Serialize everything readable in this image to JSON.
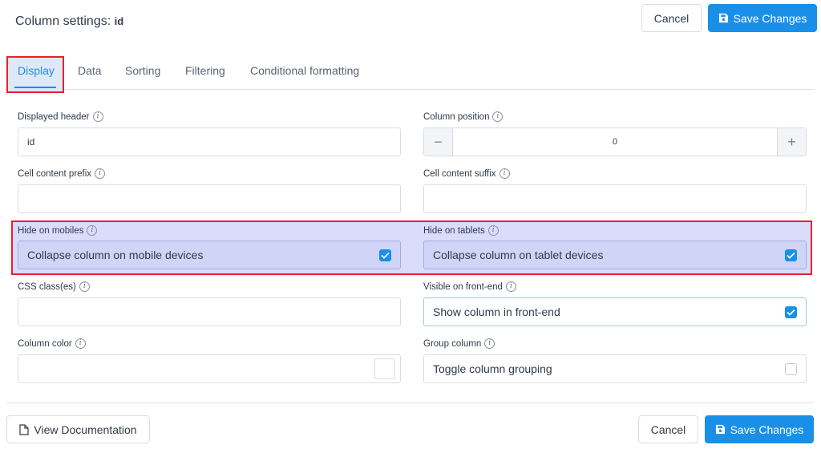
{
  "header": {
    "title_prefix": "Column settings:",
    "column_name": "id",
    "cancel_label": "Cancel",
    "save_label": "Save Changes"
  },
  "tabs": [
    {
      "label": "Display",
      "active": true
    },
    {
      "label": "Data",
      "active": false
    },
    {
      "label": "Sorting",
      "active": false
    },
    {
      "label": "Filtering",
      "active": false
    },
    {
      "label": "Conditional formatting",
      "active": false
    }
  ],
  "fields": {
    "displayed_header": {
      "label": "Displayed header",
      "value": "id"
    },
    "column_position": {
      "label": "Column position",
      "value": "0",
      "minus": "−",
      "plus": "+"
    },
    "cell_prefix": {
      "label": "Cell content prefix",
      "value": ""
    },
    "cell_suffix": {
      "label": "Cell content suffix",
      "value": ""
    },
    "hide_mobiles": {
      "label": "Hide on mobiles",
      "option": "Collapse column on mobile devices",
      "checked": true
    },
    "hide_tablets": {
      "label": "Hide on tablets",
      "option": "Collapse column on tablet devices",
      "checked": true
    },
    "css_classes": {
      "label": "CSS class(es)",
      "value": ""
    },
    "visible_frontend": {
      "label": "Visible on front-end",
      "option": "Show column in front-end",
      "checked": true
    },
    "column_color": {
      "label": "Column color",
      "value": ""
    },
    "group_column": {
      "label": "Group column",
      "option": "Toggle column grouping",
      "checked": false
    }
  },
  "footer": {
    "docs_label": "View Documentation",
    "cancel_label": "Cancel",
    "save_label": "Save Changes"
  },
  "colors": {
    "accent": "#1a8fe8",
    "highlight": "#e8202e"
  },
  "icons": {
    "info": "i"
  }
}
